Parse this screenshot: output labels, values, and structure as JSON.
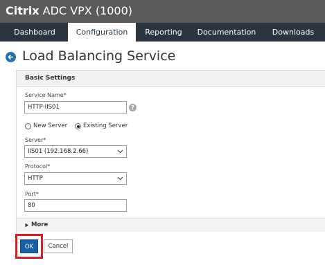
{
  "header": {
    "brand_bold": "Citrix",
    "brand_rest": " ADC VPX (1000)"
  },
  "nav": {
    "tabs": [
      {
        "label": "Dashboard"
      },
      {
        "label": "Configuration"
      },
      {
        "label": "Reporting"
      },
      {
        "label": "Documentation"
      },
      {
        "label": "Downloads"
      }
    ],
    "active": "Configuration"
  },
  "page": {
    "title": "Load Balancing Service"
  },
  "panel": {
    "header": "Basic Settings"
  },
  "form": {
    "service_name": {
      "label": "Service Name*",
      "value": "HTTP-IIS01"
    },
    "help": "?",
    "server_choice": {
      "options": [
        "New Server",
        "Existing Server"
      ],
      "selected": "Existing Server"
    },
    "server": {
      "label": "Server*",
      "value": "IIS01 (192.168.2.66)"
    },
    "protocol": {
      "label": "Protocol*",
      "value": "HTTP"
    },
    "port": {
      "label": "Port*",
      "value": "80"
    }
  },
  "more": {
    "label": "More"
  },
  "actions": {
    "ok_label": "OK",
    "cancel_label": "Cancel"
  },
  "colors": {
    "titlebar": "#5a5a5a",
    "navbar": "#2c3440",
    "primary": "#1a5fa3",
    "highlight": "#d81f26"
  }
}
